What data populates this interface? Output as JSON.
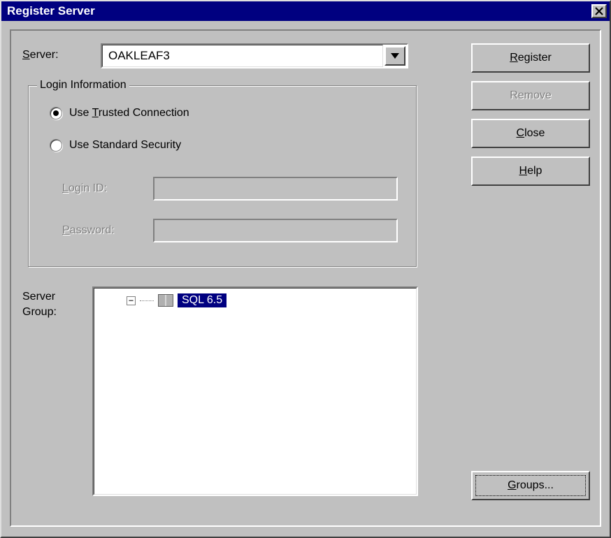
{
  "window": {
    "title": "Register Server"
  },
  "server": {
    "label": "Server:",
    "accel": "S",
    "value": "OAKLEAF3"
  },
  "login_group": {
    "title": "Login Information",
    "trusted": {
      "label": "Use Trusted Connection",
      "accel": "T",
      "checked": true
    },
    "standard": {
      "label": "Use Standard Security",
      "checked": false
    },
    "login_id": {
      "label": "Login ID:",
      "accel": "L",
      "value": ""
    },
    "password": {
      "label": "Password:",
      "accel": "P",
      "value": ""
    }
  },
  "server_group": {
    "label": "Server\nGroup:",
    "items": [
      {
        "name": "SQL 6.5",
        "selected": true,
        "expanded": false
      }
    ]
  },
  "buttons": {
    "register": {
      "label": "Register",
      "accel": "R",
      "enabled": true
    },
    "remove": {
      "label": "Remove",
      "enabled": false
    },
    "close": {
      "label": "Close",
      "accel": "C",
      "enabled": true
    },
    "help": {
      "label": "Help",
      "accel": "H",
      "enabled": true
    },
    "groups": {
      "label": "Groups...",
      "accel": "G",
      "enabled": true,
      "focused": true
    }
  }
}
